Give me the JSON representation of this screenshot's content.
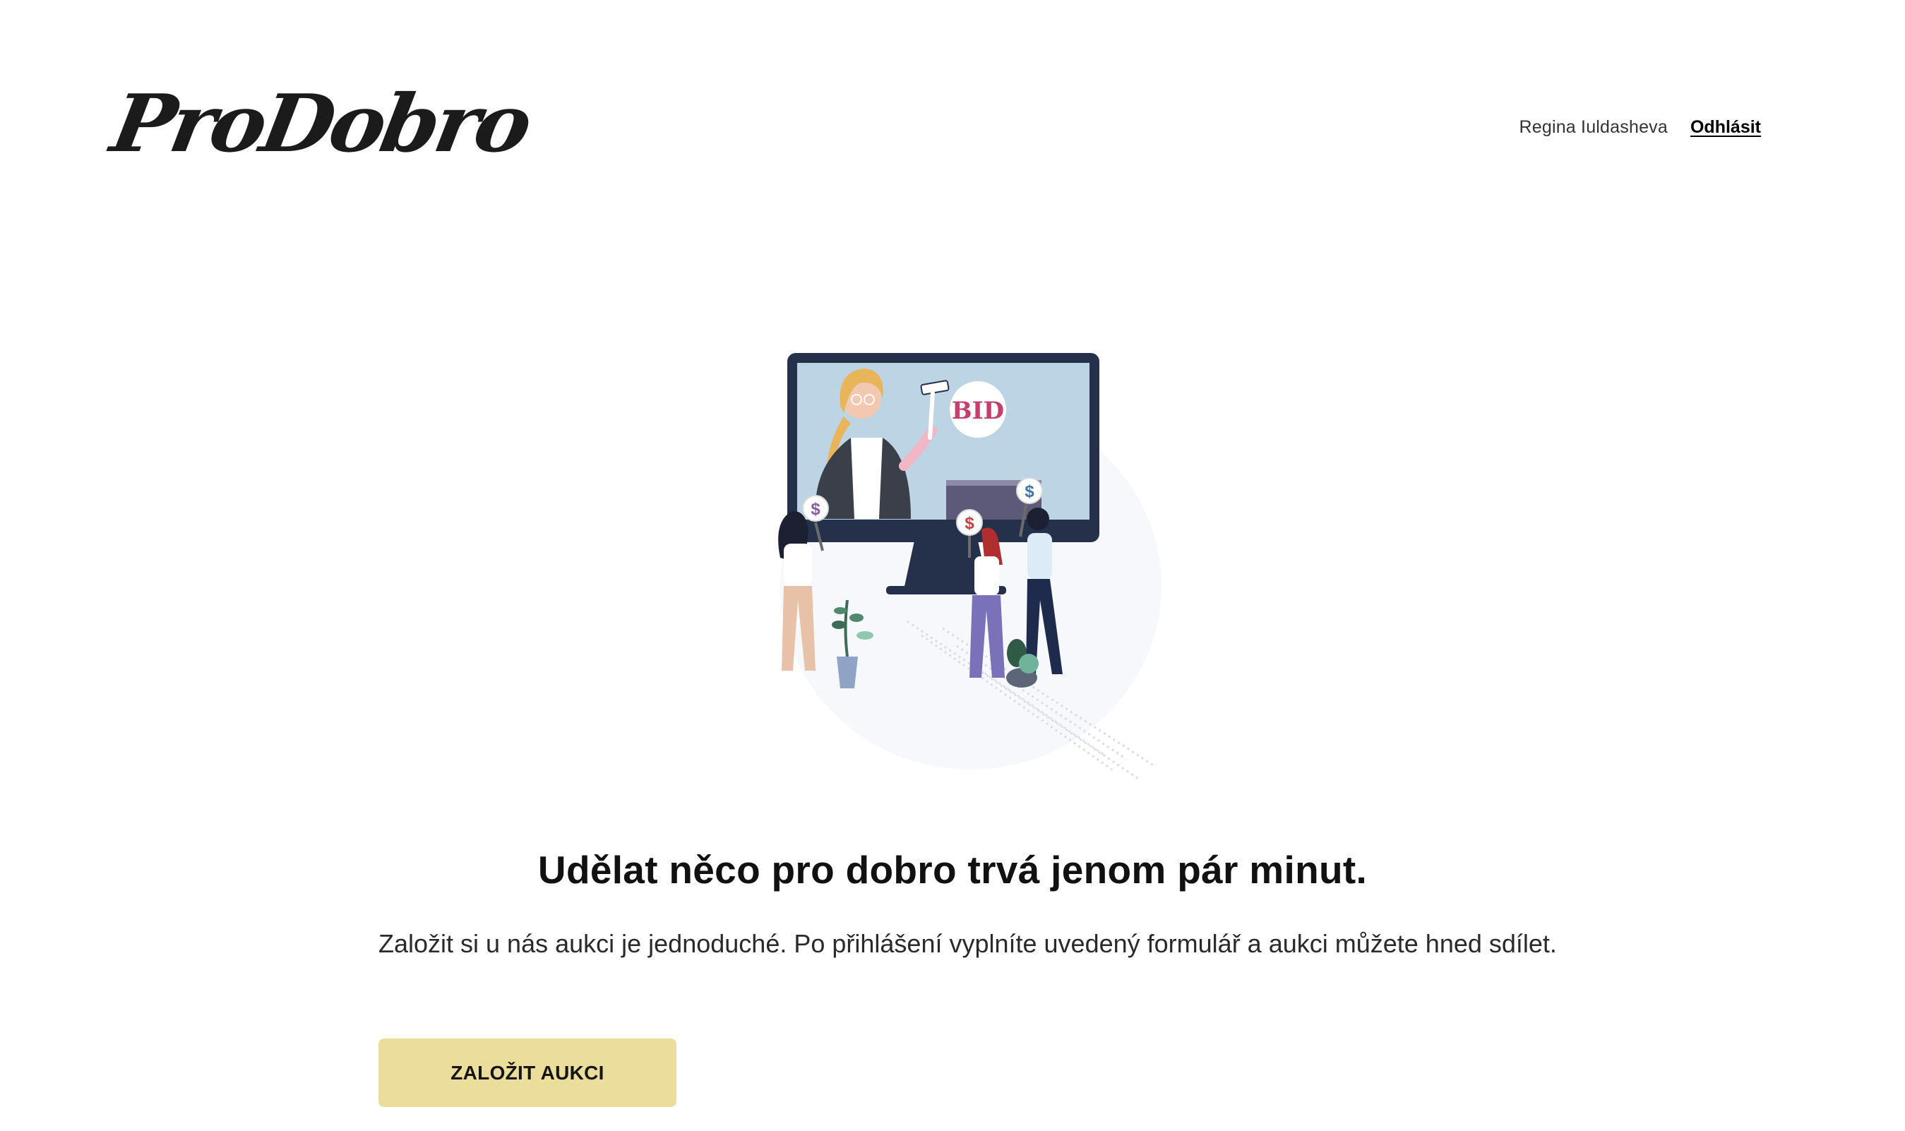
{
  "header": {
    "logo_text": "ProDobro",
    "user_name": "Regina Iuldasheva",
    "logout_label": "Odhlásit"
  },
  "hero": {
    "illustration_icon": "auction-illustration",
    "bid_sign_text": "BID",
    "paddle_symbol": "$",
    "headline": "Udělat něco pro dobro trvá jenom pár minut.",
    "description": "Založit si u nás aukci je jednoduché. Po přihlášení vyplníte uvedený formulář a aukci můžete hned sdílet.",
    "cta_label": "ZALOŽIT AUKCI"
  },
  "colors": {
    "cta_background": "#ebdd9b",
    "monitor_frame": "#25304a",
    "screen": "#bcd4e4",
    "bid_text": "#c63f6c",
    "text_primary": "#111111"
  }
}
